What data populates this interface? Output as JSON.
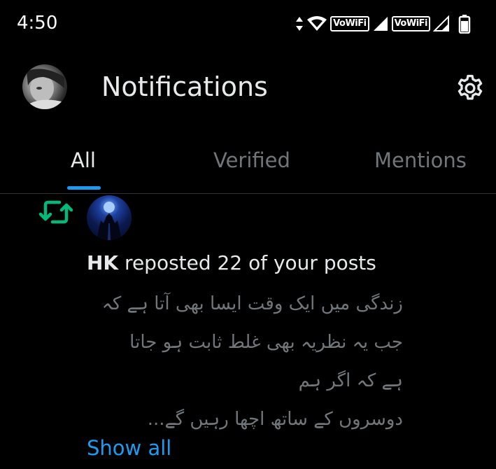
{
  "status_bar": {
    "time": "4:50",
    "network_label_1": "VoWiFi",
    "network_label_2": "VoWiFi"
  },
  "header": {
    "title": "Notifications"
  },
  "tabs": [
    {
      "label": "All",
      "active": true
    },
    {
      "label": "Verified",
      "active": false
    },
    {
      "label": "Mentions",
      "active": false
    }
  ],
  "notification": {
    "user": "HK",
    "action_text": " reposted 22 of your posts",
    "post_lines": [
      "زندگی میں ایک وقت ایسا بھی آتا ہے کہ",
      "جب یہ نظریہ بھی غلط ثابت ہو جاتا",
      "ہے کہ اگر ہم",
      "دوسروں کے ساتھ اچھا رہیں گے..."
    ],
    "show_all_label": "Show all"
  },
  "colors": {
    "background": "#000000",
    "accent": "#1d9bf0",
    "repost": "#00ba7c",
    "muted": "#71767b"
  }
}
